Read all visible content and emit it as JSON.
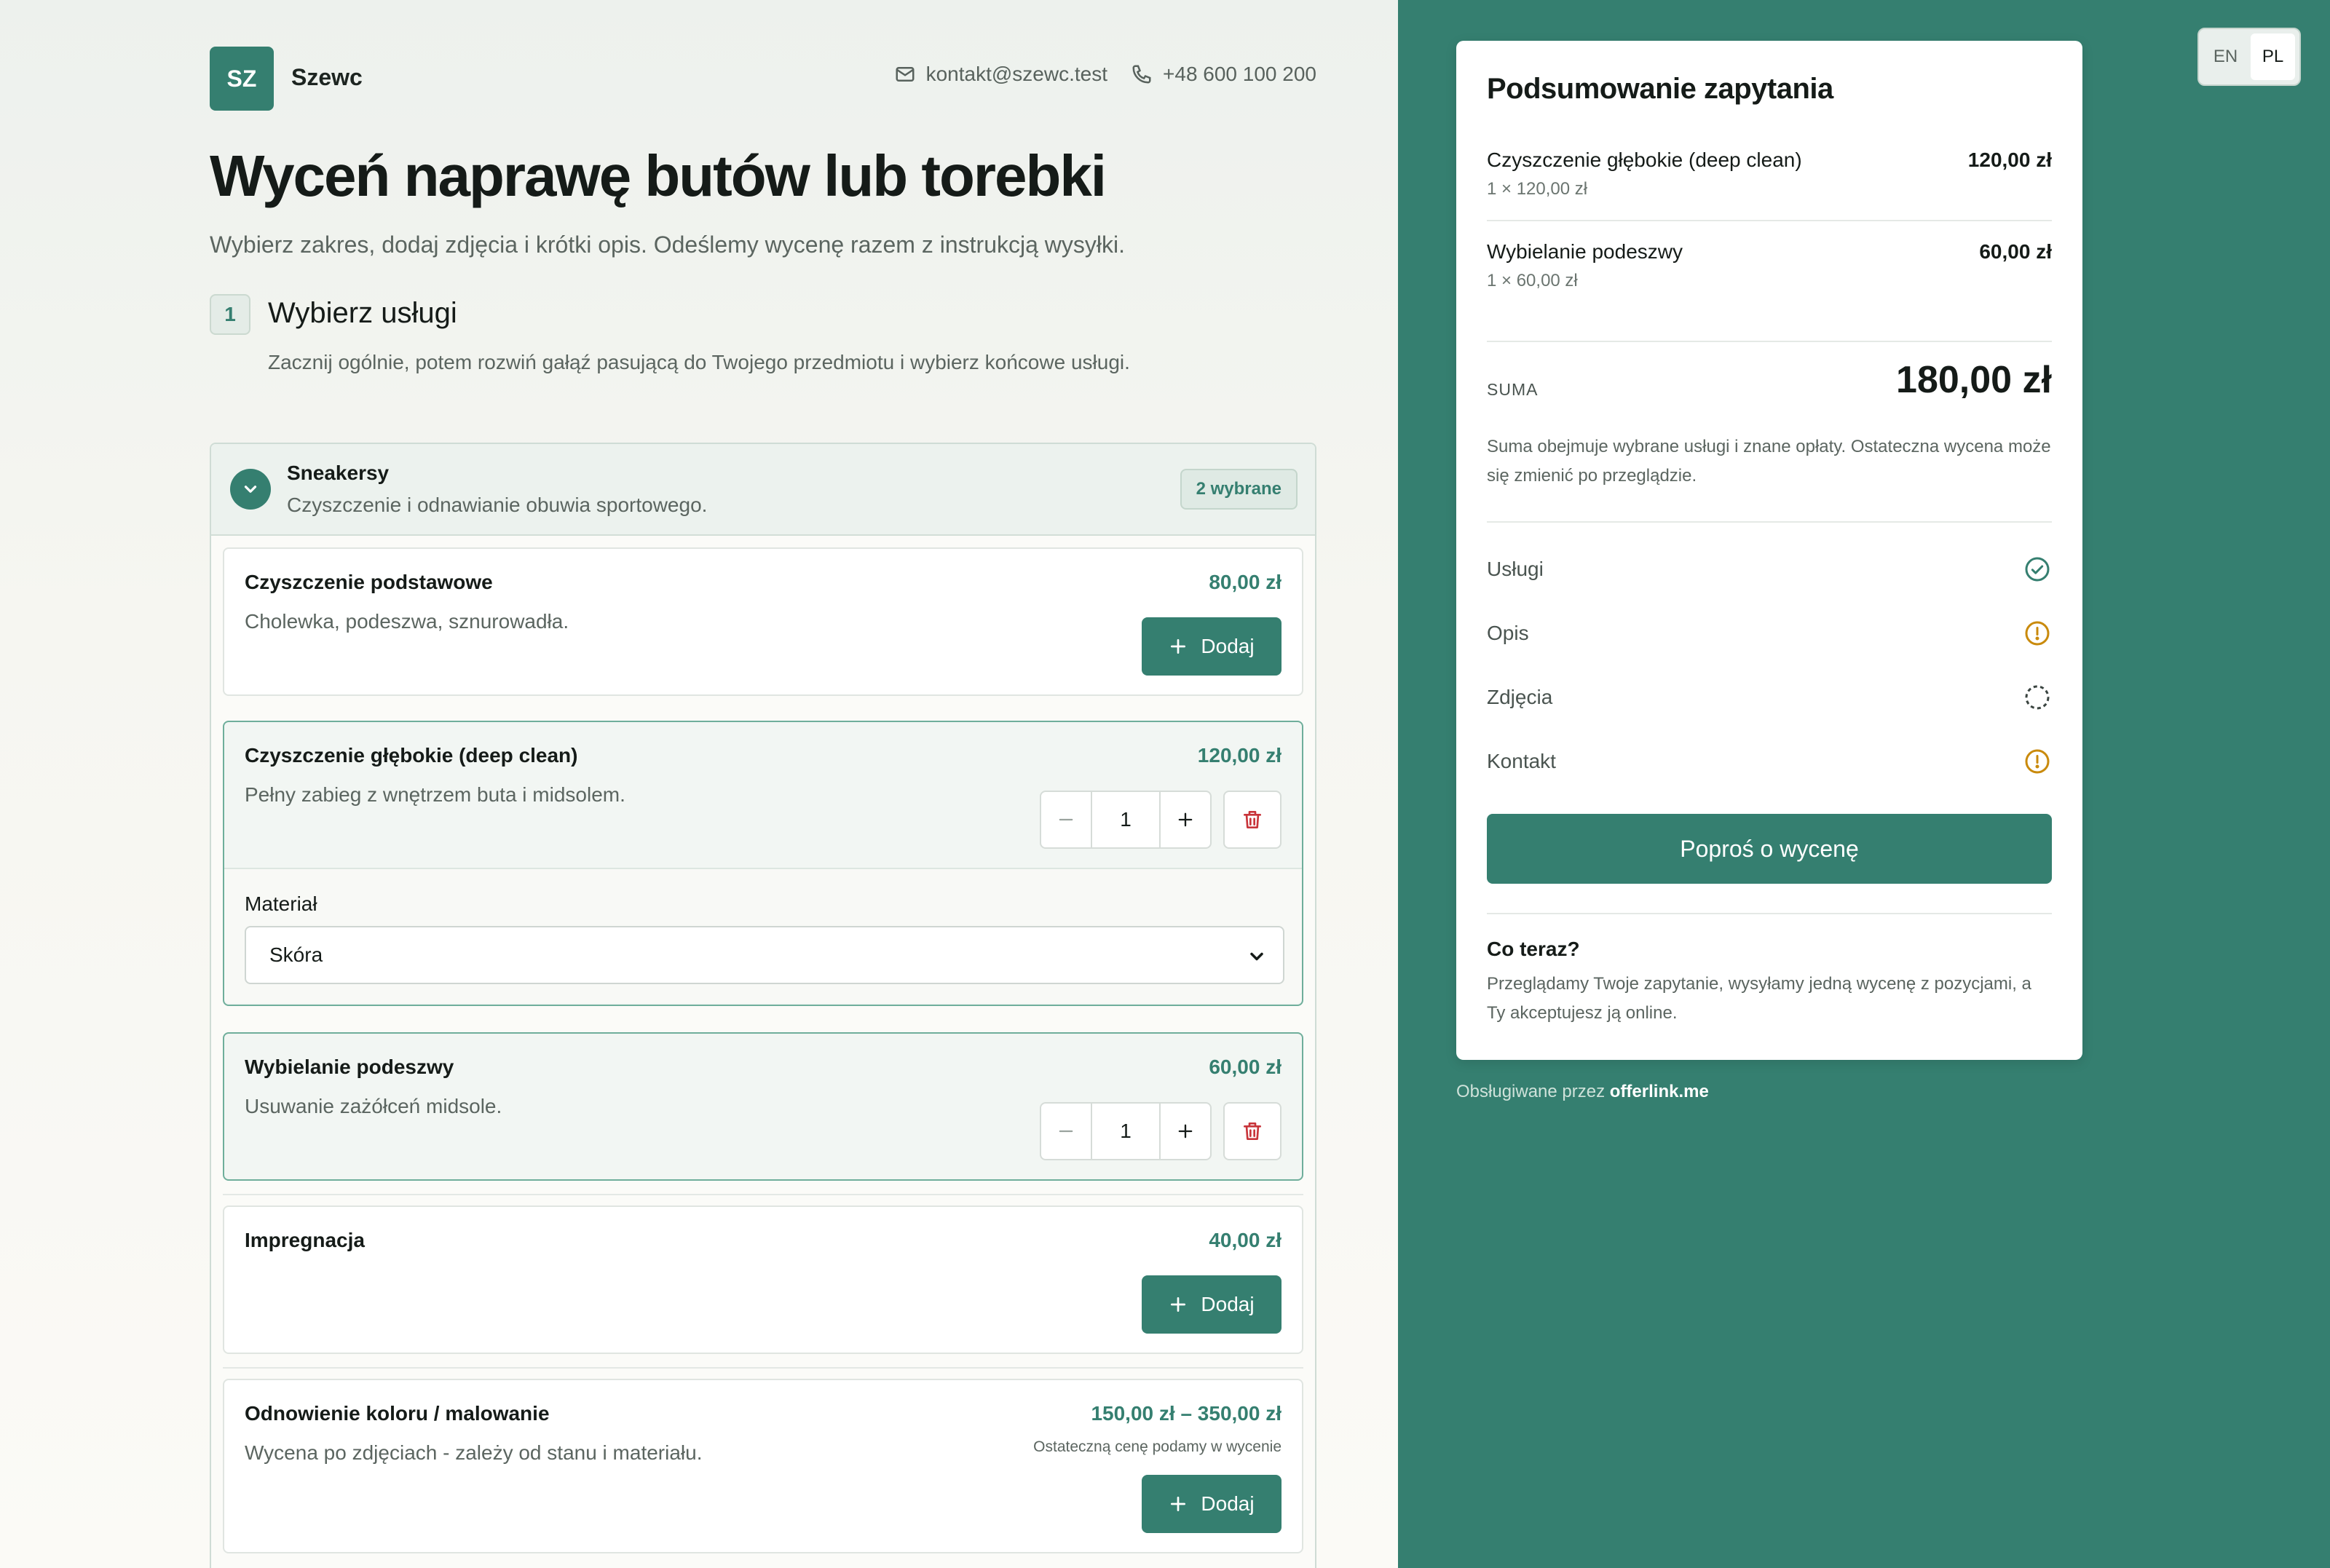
{
  "header": {
    "logo_initials": "SZ",
    "brand_name": "Szewc",
    "email": "kontakt@szewc.test",
    "phone": "+48 600 100 200"
  },
  "page": {
    "title": "Wyceń naprawę butów lub torebki",
    "subtitle": "Wybierz zakres, dodaj zdjęcia i krótki opis. Odeślemy wycenę razem z instrukcją wysyłki."
  },
  "step": {
    "number": "1",
    "title": "Wybierz usługi",
    "description": "Zacznij ogólnie, potem rozwiń gałąź pasującą do Twojego przedmiotu i wybierz końcowe usługi."
  },
  "group": {
    "title": "Sneakersy",
    "subtitle": "Czyszczenie i odnawianie obuwia sportowego.",
    "badge": "2 wybrane"
  },
  "services": [
    {
      "name": "Czyszczenie podstawowe",
      "description": "Cholewka, podeszwa, sznurowadła.",
      "price": "80,00 zł",
      "action_label": "Dodaj"
    },
    {
      "name": "Czyszczenie głębokie (deep clean)",
      "description": "Pełny zabieg z wnętrzem buta i midsolem.",
      "price": "120,00 zł",
      "quantity": "1",
      "material_label": "Materiał",
      "material_value": "Skóra"
    },
    {
      "name": "Wybielanie podeszwy",
      "description": "Usuwanie zażółceń midsole.",
      "price": "60,00 zł",
      "quantity": "1"
    },
    {
      "name": "Impregnacja",
      "description": "",
      "price": "40,00 zł",
      "action_label": "Dodaj"
    },
    {
      "name": "Odnowienie koloru / malowanie",
      "description": "Wycena po zdjęciach - zależy od stanu i materiału.",
      "price": "150,00 zł – 350,00 zł",
      "price_note": "Ostateczną cenę podamy w wycenie",
      "action_label": "Dodaj"
    }
  ],
  "language": {
    "options": [
      "EN",
      "PL"
    ],
    "active": "PL"
  },
  "summary": {
    "title": "Podsumowanie zapytania",
    "items": [
      {
        "name": "Czyszczenie głębokie (deep clean)",
        "qty_line": "1 × 120,00 zł",
        "amount": "120,00 zł"
      },
      {
        "name": "Wybielanie podeszwy",
        "qty_line": "1 × 60,00 zł",
        "amount": "60,00 zł"
      }
    ],
    "total_label": "SUMA",
    "total_value": "180,00 zł",
    "total_note": "Suma obejmuje wybrane usługi i znane opłaty. Ostateczna wycena może się zmienić po przeglądzie.",
    "checklist": [
      {
        "label": "Usługi",
        "status": "done"
      },
      {
        "label": "Opis",
        "status": "warning"
      },
      {
        "label": "Zdjęcia",
        "status": "pending"
      },
      {
        "label": "Kontakt",
        "status": "warning"
      }
    ],
    "cta_label": "Poproś o wycenę",
    "next_title": "Co teraz?",
    "next_desc": "Przeglądamy Twoje zapytanie, wysyłamy jedną wycenę z pozycjami, a Ty akceptujesz ją online."
  },
  "footer": {
    "powered_prefix": "Obsługiwane przez",
    "powered_brand": "offerlink.me"
  },
  "colors": {
    "accent": "#357f70",
    "warning": "#c98a0c",
    "danger": "#c8343a"
  }
}
